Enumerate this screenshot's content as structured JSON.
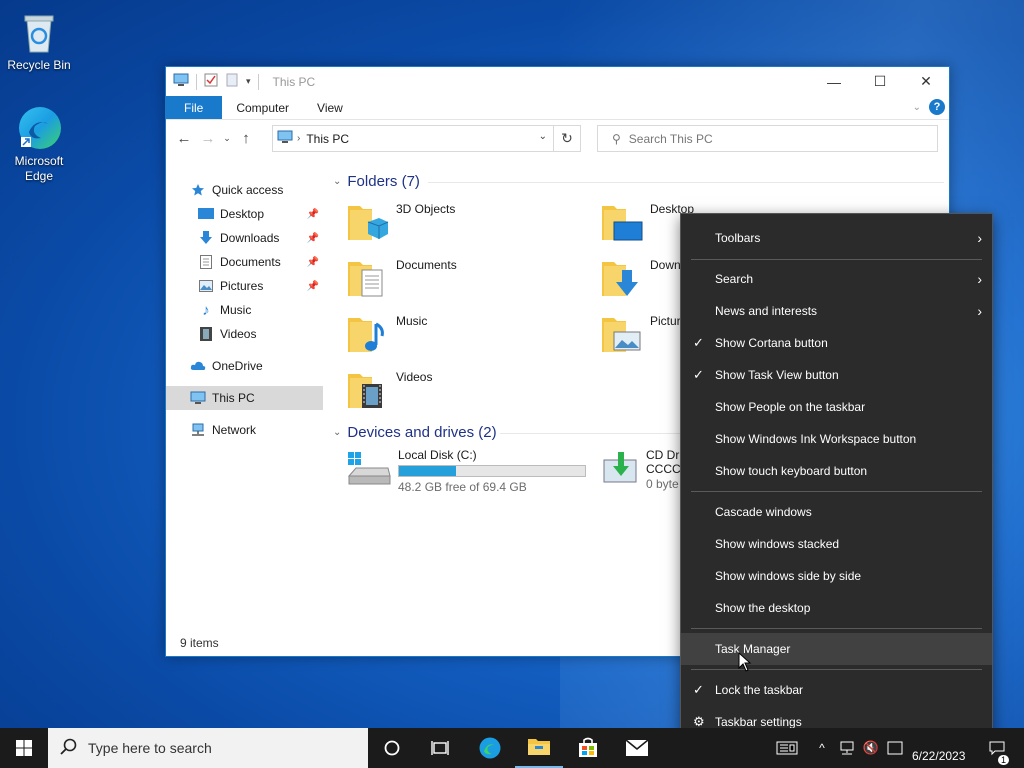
{
  "desktop": {
    "icons": [
      {
        "label": "Recycle Bin",
        "icon": "recycle-bin-icon"
      },
      {
        "label": "Microsoft\nEdge",
        "icon": "edge-icon"
      }
    ]
  },
  "explorer": {
    "title": "This PC",
    "ribbon_tabs": [
      "File",
      "Computer",
      "View"
    ],
    "address": {
      "path": "This PC"
    },
    "search": {
      "placeholder": "Search This PC"
    },
    "sidebar": {
      "items": [
        {
          "label": "Quick access",
          "icon": "star-icon",
          "pinned": false
        },
        {
          "label": "Desktop",
          "icon": "desktop-folder-icon",
          "pinned": true
        },
        {
          "label": "Downloads",
          "icon": "download-arrow-icon",
          "pinned": true
        },
        {
          "label": "Documents",
          "icon": "document-icon",
          "pinned": true
        },
        {
          "label": "Pictures",
          "icon": "picture-icon",
          "pinned": true
        },
        {
          "label": "Music",
          "icon": "music-note-icon",
          "pinned": false
        },
        {
          "label": "Videos",
          "icon": "film-icon",
          "pinned": false
        },
        {
          "label": "OneDrive",
          "icon": "cloud-icon",
          "pinned": false
        },
        {
          "label": "This PC",
          "icon": "computer-icon",
          "pinned": false,
          "selected": true
        },
        {
          "label": "Network",
          "icon": "network-icon",
          "pinned": false
        }
      ]
    },
    "folders_group": {
      "header": "Folders (7)",
      "items": [
        {
          "label": "3D Objects",
          "icon": "3d-objects-folder-icon"
        },
        {
          "label": "Desktop",
          "icon": "desktop-folder-icon"
        },
        {
          "label": "Documents",
          "icon": "documents-folder-icon"
        },
        {
          "label": "Down",
          "icon": "downloads-folder-icon"
        },
        {
          "label": "Music",
          "icon": "music-folder-icon"
        },
        {
          "label": "Pictur",
          "icon": "pictures-folder-icon"
        },
        {
          "label": "Videos",
          "icon": "videos-folder-icon"
        }
      ]
    },
    "drives_group": {
      "header": "Devices and drives (2)",
      "items": [
        {
          "label": "Local Disk (C:)",
          "free": "48.2 GB free of 69.4 GB",
          "used_fraction": 0.305,
          "icon": "hard-drive-icon"
        },
        {
          "label": "CD Dr",
          "label2": "CCCC",
          "free": "0 byte",
          "icon": "cd-drive-icon"
        }
      ]
    },
    "status": "9 items",
    "accent": "#1979ca"
  },
  "context_menu": {
    "items": [
      {
        "label": "Toolbars",
        "submenu": true
      },
      {
        "label": "Search",
        "submenu": true
      },
      {
        "label": "News and interests",
        "submenu": true
      },
      {
        "label": "Show Cortana button",
        "checked": true
      },
      {
        "label": "Show Task View button",
        "checked": true
      },
      {
        "label": "Show People on the taskbar"
      },
      {
        "label": "Show Windows Ink Workspace button"
      },
      {
        "label": "Show touch keyboard button"
      },
      {
        "label": "Cascade windows"
      },
      {
        "label": "Show windows stacked"
      },
      {
        "label": "Show windows side by side"
      },
      {
        "label": "Show the desktop"
      },
      {
        "label": "Task Manager",
        "hover": true
      },
      {
        "label": "Lock the taskbar",
        "checked": true
      },
      {
        "label": "Taskbar settings",
        "icon": "gear-icon"
      }
    ]
  },
  "taskbar": {
    "search_placeholder": "Type here to search",
    "date": "6/22/2023",
    "notification_count": "1"
  }
}
